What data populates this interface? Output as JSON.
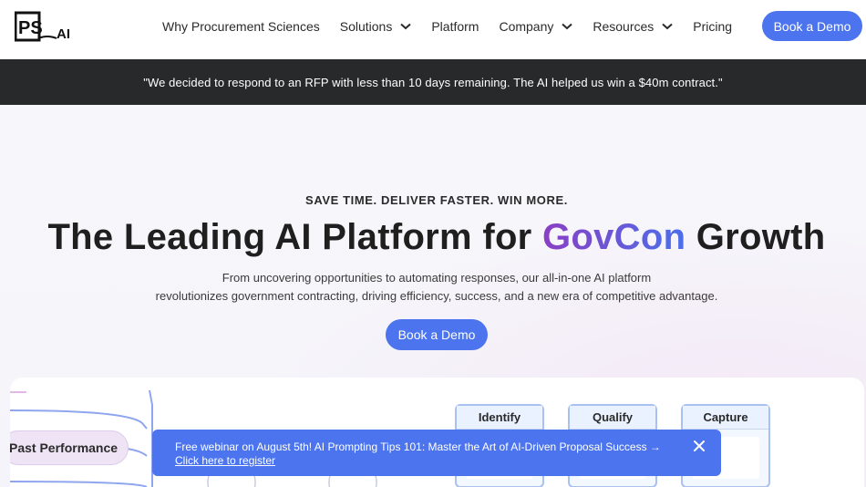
{
  "brand": {
    "logo_text": "PS",
    "logo_suffix": "AI"
  },
  "nav": {
    "items": [
      {
        "label": "Why Procurement Sciences",
        "has_dropdown": false
      },
      {
        "label": "Solutions",
        "has_dropdown": true
      },
      {
        "label": "Platform",
        "has_dropdown": false
      },
      {
        "label": "Company",
        "has_dropdown": true
      },
      {
        "label": "Resources",
        "has_dropdown": true
      },
      {
        "label": "Pricing",
        "has_dropdown": false
      }
    ],
    "cta_label": "Book a Demo"
  },
  "quote_banner": {
    "text": "\"We decided to respond to an RFP with less than 10 days remaining. The AI helped us win a $40m contract.\""
  },
  "hero": {
    "eyebrow": "SAVE TIME. DELIVER FASTER. WIN MORE.",
    "headline_before": "The Leading AI Platform for ",
    "headline_accent": "GovCon",
    "headline_after": " Growth",
    "subtext_line1": "From uncovering opportunities to automating responses, our all-in-one AI platform",
    "subtext_line2": "revolutionizes government contracting, driving efficiency, success, and a new era of competitive advantage.",
    "cta_label": "Book a Demo"
  },
  "illustration": {
    "pill_label": "Past Performance",
    "stages": [
      "Identify",
      "Qualify",
      "Capture"
    ]
  },
  "toast": {
    "message": "Free webinar on August 5th! AI Prompting Tips 101: Master the Art of AI-Driven Proposal Success →",
    "link_text": "Click here to register"
  },
  "colors": {
    "primary": "#4b74ee",
    "banner_bg": "#27292b",
    "accent_gradient_start": "#8a3fc4",
    "accent_gradient_end": "#4b6fea"
  },
  "icons": {
    "dropdown": "chevron-down-icon",
    "close": "close-icon"
  }
}
